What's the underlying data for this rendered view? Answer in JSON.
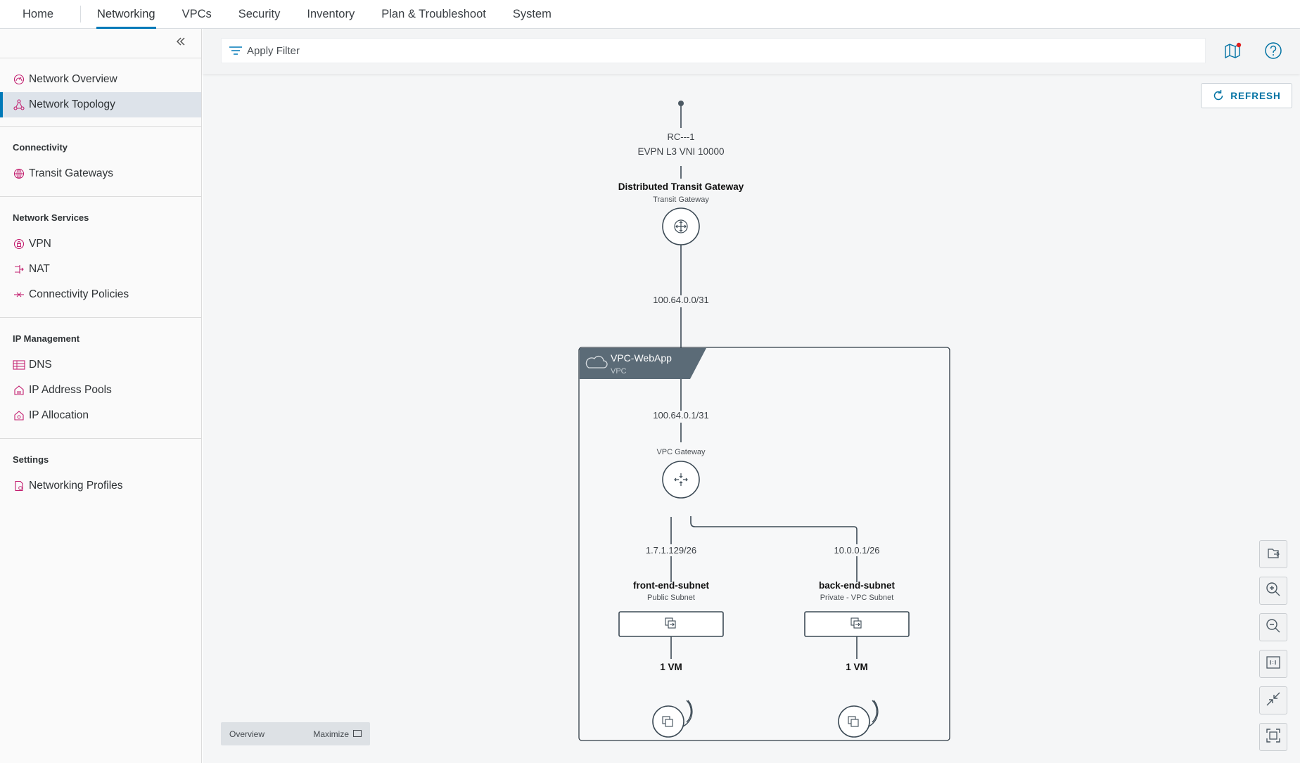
{
  "nav": {
    "tabs": [
      "Home",
      "Networking",
      "VPCs",
      "Security",
      "Inventory",
      "Plan & Troubleshoot",
      "System"
    ],
    "active_tab": "Networking"
  },
  "sidebar": {
    "collapse_icon": "double-chevron-left-icon",
    "top_items": [
      {
        "label": "Network Overview",
        "icon": "gauge-icon"
      },
      {
        "label": "Network Topology",
        "icon": "topology-icon",
        "active": true
      }
    ],
    "sections": [
      {
        "title": "Connectivity",
        "items": [
          {
            "label": "Transit Gateways",
            "icon": "globe-icon"
          }
        ]
      },
      {
        "title": "Network Services",
        "items": [
          {
            "label": "VPN",
            "icon": "lock-icon"
          },
          {
            "label": "NAT",
            "icon": "nat-icon"
          },
          {
            "label": "Connectivity Policies",
            "icon": "policy-icon"
          }
        ]
      },
      {
        "title": "IP Management",
        "items": [
          {
            "label": "DNS",
            "icon": "dns-icon"
          },
          {
            "label": "IP Address Pools",
            "icon": "ip-pool-icon"
          },
          {
            "label": "IP Allocation",
            "icon": "ip-allocation-icon"
          }
        ]
      },
      {
        "title": "Settings",
        "items": [
          {
            "label": "Networking Profiles",
            "icon": "profile-icon"
          }
        ]
      }
    ]
  },
  "filter": {
    "placeholder": "Apply Filter"
  },
  "toolbar": {
    "refresh_label": "REFRESH"
  },
  "topology": {
    "edge_router": {
      "name": "RC---1",
      "detail": "EVPN L3 VNI 10000"
    },
    "transit_gateway": {
      "name": "Distributed Transit Gateway",
      "type": "Transit Gateway"
    },
    "uplink_cidr": "100.64.0.0/31",
    "vpc": {
      "name": "VPC-WebApp",
      "type": "VPC"
    },
    "vpc_uplink_cidr": "100.64.0.1/31",
    "vpc_gateway": {
      "name": "VPC Gateway"
    },
    "subnets": [
      {
        "cidr": "1.7.1.129/26",
        "name": "front-end-subnet",
        "type": "Public Subnet",
        "vms": "1 VM"
      },
      {
        "cidr": "10.0.0.1/26",
        "name": "back-end-subnet",
        "type": "Private - VPC Subnet",
        "vms": "1 VM"
      }
    ]
  },
  "overview_bar": {
    "overview_label": "Overview",
    "maximize_label": "Maximize"
  },
  "colors": {
    "accent": "#0079b8",
    "line": "#3c4a55",
    "vpc_header": "#5b6b77",
    "icon_pink": "#c21d6e"
  }
}
